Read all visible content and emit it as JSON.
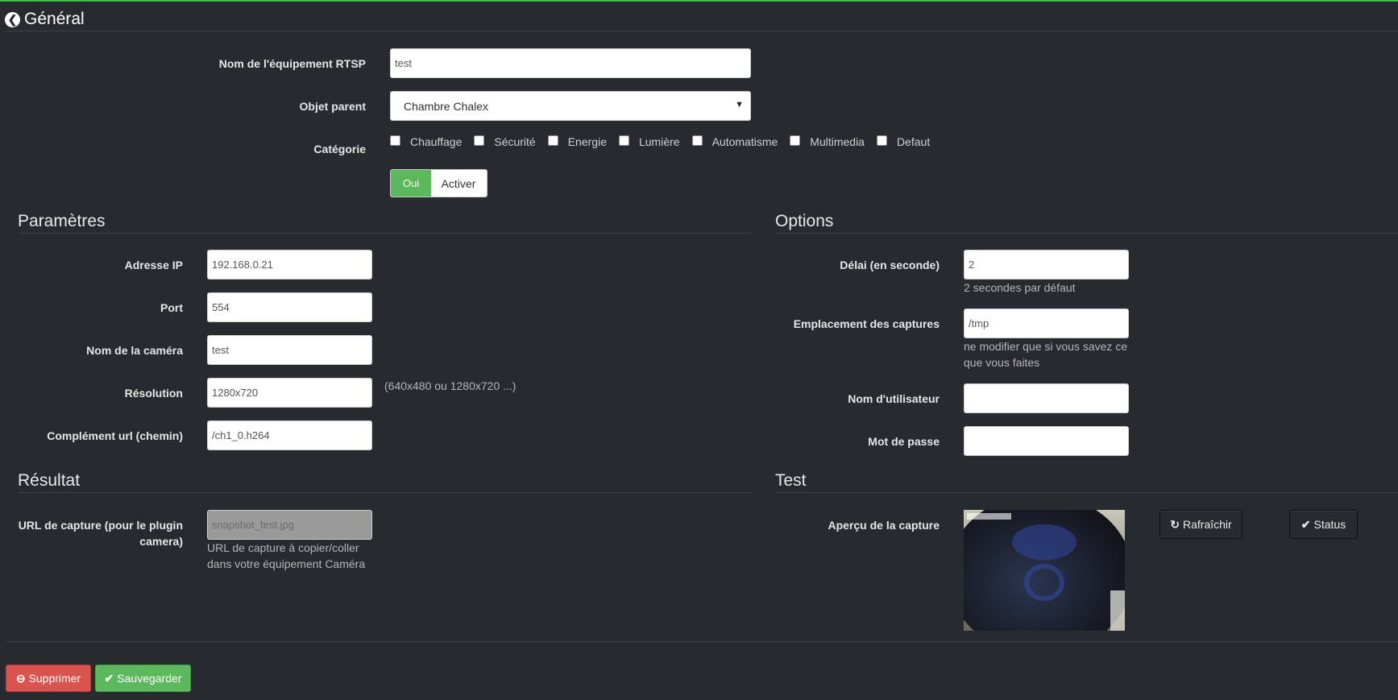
{
  "header": {
    "title": "Général"
  },
  "general": {
    "name_label": "Nom de l'équipement RTSP",
    "name_value": "test",
    "parent_label": "Objet parent",
    "parent_value": "Chambre Chalex",
    "category_label": "Catégorie",
    "categories": [
      "Chauffage",
      "Sécurité",
      "Energie",
      "Lumière",
      "Automatisme",
      "Multimedia",
      "Defaut"
    ],
    "enable_on": "Oui",
    "enable_label": "Activer"
  },
  "params": {
    "title": "Paramètres",
    "ip_label": "Adresse IP",
    "ip_value": "192.168.0.21",
    "port_label": "Port",
    "port_value": "554",
    "camname_label": "Nom de la caméra",
    "camname_value": "test",
    "res_label": "Résolution",
    "res_value": "1280x720",
    "res_help": "(640x480 ou 1280x720 ...)",
    "url_label": "Complément url (chemin)",
    "url_value": "/ch1_0.h264"
  },
  "options": {
    "title": "Options",
    "delay_label": "Délai (en seconde)",
    "delay_value": "2",
    "delay_help": "2 secondes par défaut",
    "location_label": "Emplacement des captures",
    "location_value": "/tmp",
    "location_help_1": "ne modifier que si vous savez ce",
    "location_help_2": "que vous faites",
    "user_label": "Nom d'utilisateur",
    "user_value": "",
    "pass_label": "Mot de passe",
    "pass_value": ""
  },
  "result": {
    "title": "Résultat",
    "capture_label_1": "URL de capture (pour le plugin",
    "capture_label_2": "camera)",
    "capture_value": "snapshot_test.jpg",
    "capture_help_1": "URL de capture à copier/coller",
    "capture_help_2": "dans votre équipement Caméra"
  },
  "test": {
    "title": "Test",
    "preview_label": "Aperçu de la capture",
    "refresh_label": "Rafraîchir",
    "status_label": "Status"
  },
  "footer": {
    "delete_label": "Supprimer",
    "save_label": "Sauvegarder"
  },
  "colors": {
    "background": "#272b30",
    "accent_green": "#5cb85c",
    "danger_red": "#d9534f",
    "top_border": "#3fbe4a"
  }
}
